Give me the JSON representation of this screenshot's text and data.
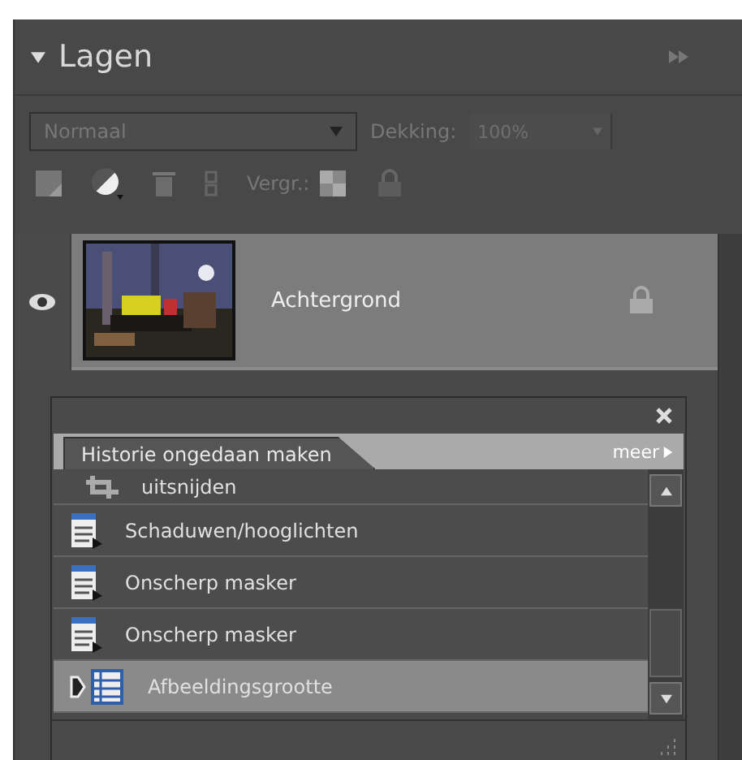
{
  "panel": {
    "title": "Lagen",
    "expanded": true
  },
  "blend_mode": {
    "value": "Normaal"
  },
  "opacity": {
    "label": "Dekking:",
    "value": "100%"
  },
  "lock_label": "Vergr.:",
  "layers": [
    {
      "name": "Achtergrond",
      "visible": true,
      "locked": true,
      "selected": true
    }
  ],
  "history": {
    "tab": "Historie ongedaan maken",
    "more": "meer",
    "items": [
      {
        "label": "uitsnijden",
        "kind": "crop",
        "selected": false
      },
      {
        "label": "Schaduwen/hooglichten",
        "kind": "filter",
        "selected": false
      },
      {
        "label": "Onscherp masker",
        "kind": "filter",
        "selected": false
      },
      {
        "label": "Onscherp masker",
        "kind": "filter",
        "selected": false
      },
      {
        "label": "Afbeeldingsgrootte",
        "kind": "resize",
        "selected": true
      }
    ]
  }
}
